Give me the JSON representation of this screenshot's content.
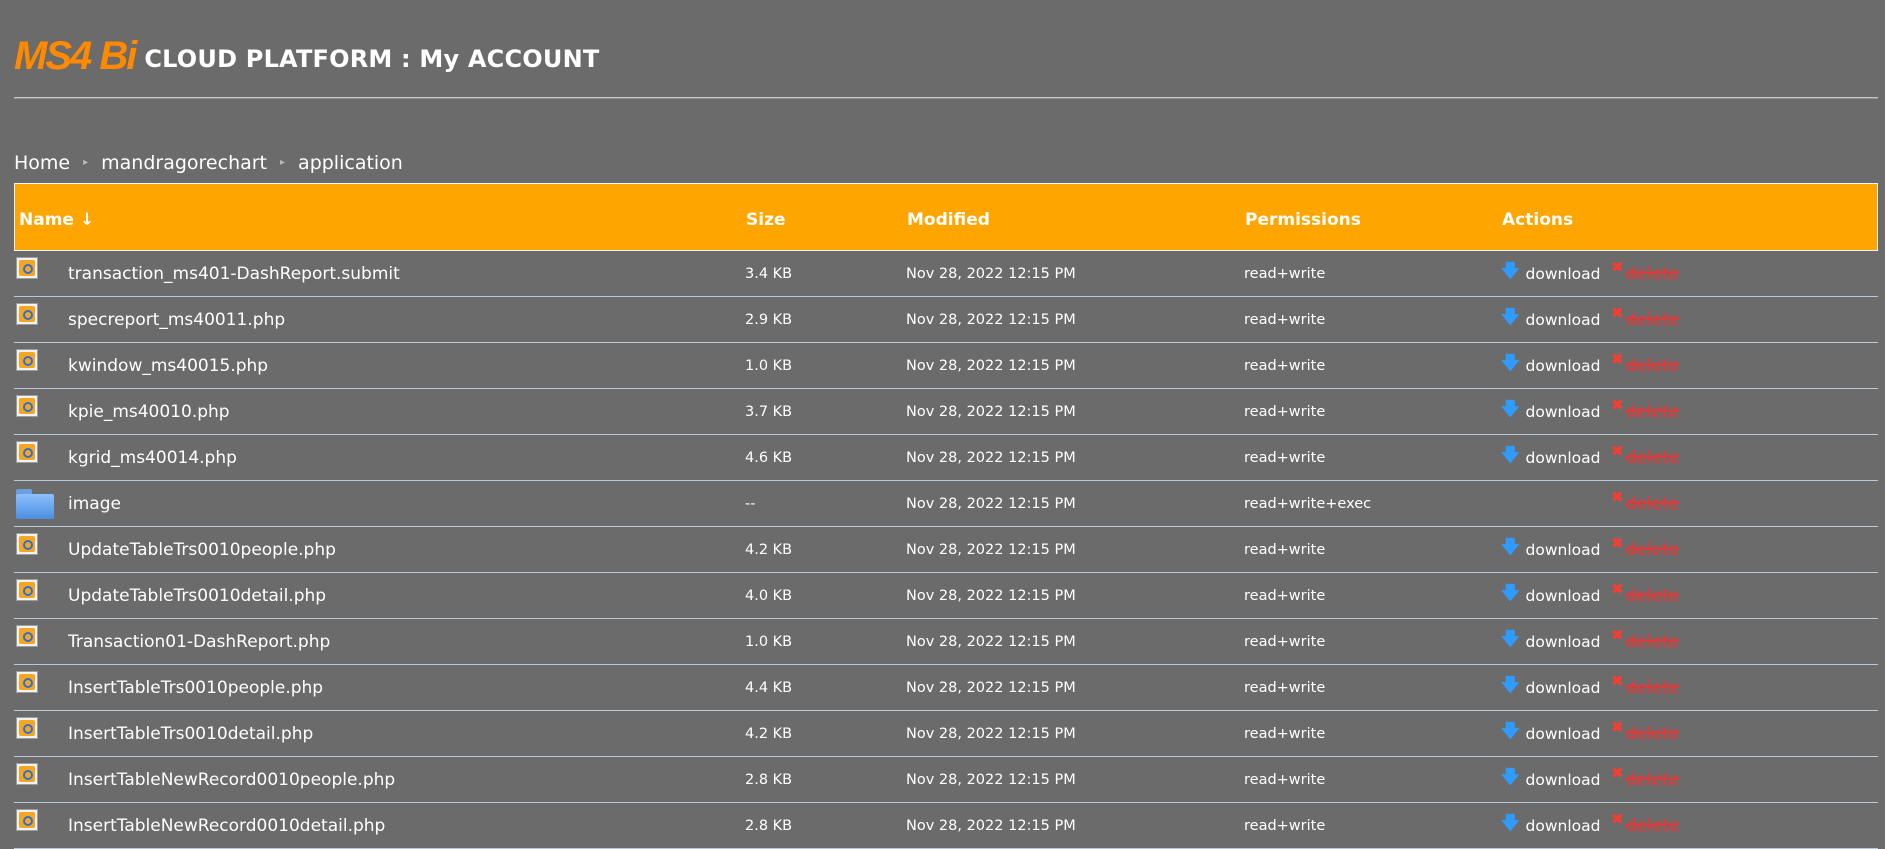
{
  "header": {
    "logo": "MS4 Bi",
    "title": "CLOUD PLATFORM : My ACCOUNT"
  },
  "breadcrumb": [
    "Home",
    "mandragorechart",
    "application"
  ],
  "columns": {
    "name": "Name",
    "sort_arrow": "↓",
    "size": "Size",
    "modified": "Modified",
    "permissions": "Permissions",
    "actions": "Actions"
  },
  "actions": {
    "download": "download",
    "delete": "delete"
  },
  "colors": {
    "background": "#6b6b6b",
    "header_bar": "#ffa500",
    "logo": "#ff8a00",
    "delete": "#ff2e2e",
    "download_arrow": "#2f9bff"
  },
  "rows": [
    {
      "icon": "php-file-icon",
      "name": "transaction_ms401-DashReport.submit",
      "size": "3.4 KB",
      "modified": "Nov 28, 2022 12:15 PM",
      "permissions": "read+write",
      "download": true
    },
    {
      "icon": "php-file-icon",
      "name": "specreport_ms40011.php",
      "size": "2.9 KB",
      "modified": "Nov 28, 2022 12:15 PM",
      "permissions": "read+write",
      "download": true
    },
    {
      "icon": "php-file-icon",
      "name": "kwindow_ms40015.php",
      "size": "1.0 KB",
      "modified": "Nov 28, 2022 12:15 PM",
      "permissions": "read+write",
      "download": true
    },
    {
      "icon": "php-file-icon",
      "name": "kpie_ms40010.php",
      "size": "3.7 KB",
      "modified": "Nov 28, 2022 12:15 PM",
      "permissions": "read+write",
      "download": true
    },
    {
      "icon": "php-file-icon",
      "name": "kgrid_ms40014.php",
      "size": "4.6 KB",
      "modified": "Nov 28, 2022 12:15 PM",
      "permissions": "read+write",
      "download": true
    },
    {
      "icon": "folder-icon",
      "name": "image",
      "size": "--",
      "modified": "Nov 28, 2022 12:15 PM",
      "permissions": "read+write+exec",
      "download": false
    },
    {
      "icon": "php-file-icon",
      "name": "UpdateTableTrs0010people.php",
      "size": "4.2 KB",
      "modified": "Nov 28, 2022 12:15 PM",
      "permissions": "read+write",
      "download": true
    },
    {
      "icon": "php-file-icon",
      "name": "UpdateTableTrs0010detail.php",
      "size": "4.0 KB",
      "modified": "Nov 28, 2022 12:15 PM",
      "permissions": "read+write",
      "download": true
    },
    {
      "icon": "php-file-icon",
      "name": "Transaction01-DashReport.php",
      "size": "1.0 KB",
      "modified": "Nov 28, 2022 12:15 PM",
      "permissions": "read+write",
      "download": true
    },
    {
      "icon": "php-file-icon",
      "name": "InsertTableTrs0010people.php",
      "size": "4.4 KB",
      "modified": "Nov 28, 2022 12:15 PM",
      "permissions": "read+write",
      "download": true
    },
    {
      "icon": "php-file-icon",
      "name": "InsertTableTrs0010detail.php",
      "size": "4.2 KB",
      "modified": "Nov 28, 2022 12:15 PM",
      "permissions": "read+write",
      "download": true
    },
    {
      "icon": "php-file-icon",
      "name": "InsertTableNewRecord0010people.php",
      "size": "2.8 KB",
      "modified": "Nov 28, 2022 12:15 PM",
      "permissions": "read+write",
      "download": true
    },
    {
      "icon": "php-file-icon",
      "name": "InsertTableNewRecord0010detail.php",
      "size": "2.8 KB",
      "modified": "Nov 28, 2022 12:15 PM",
      "permissions": "read+write",
      "download": true
    }
  ]
}
